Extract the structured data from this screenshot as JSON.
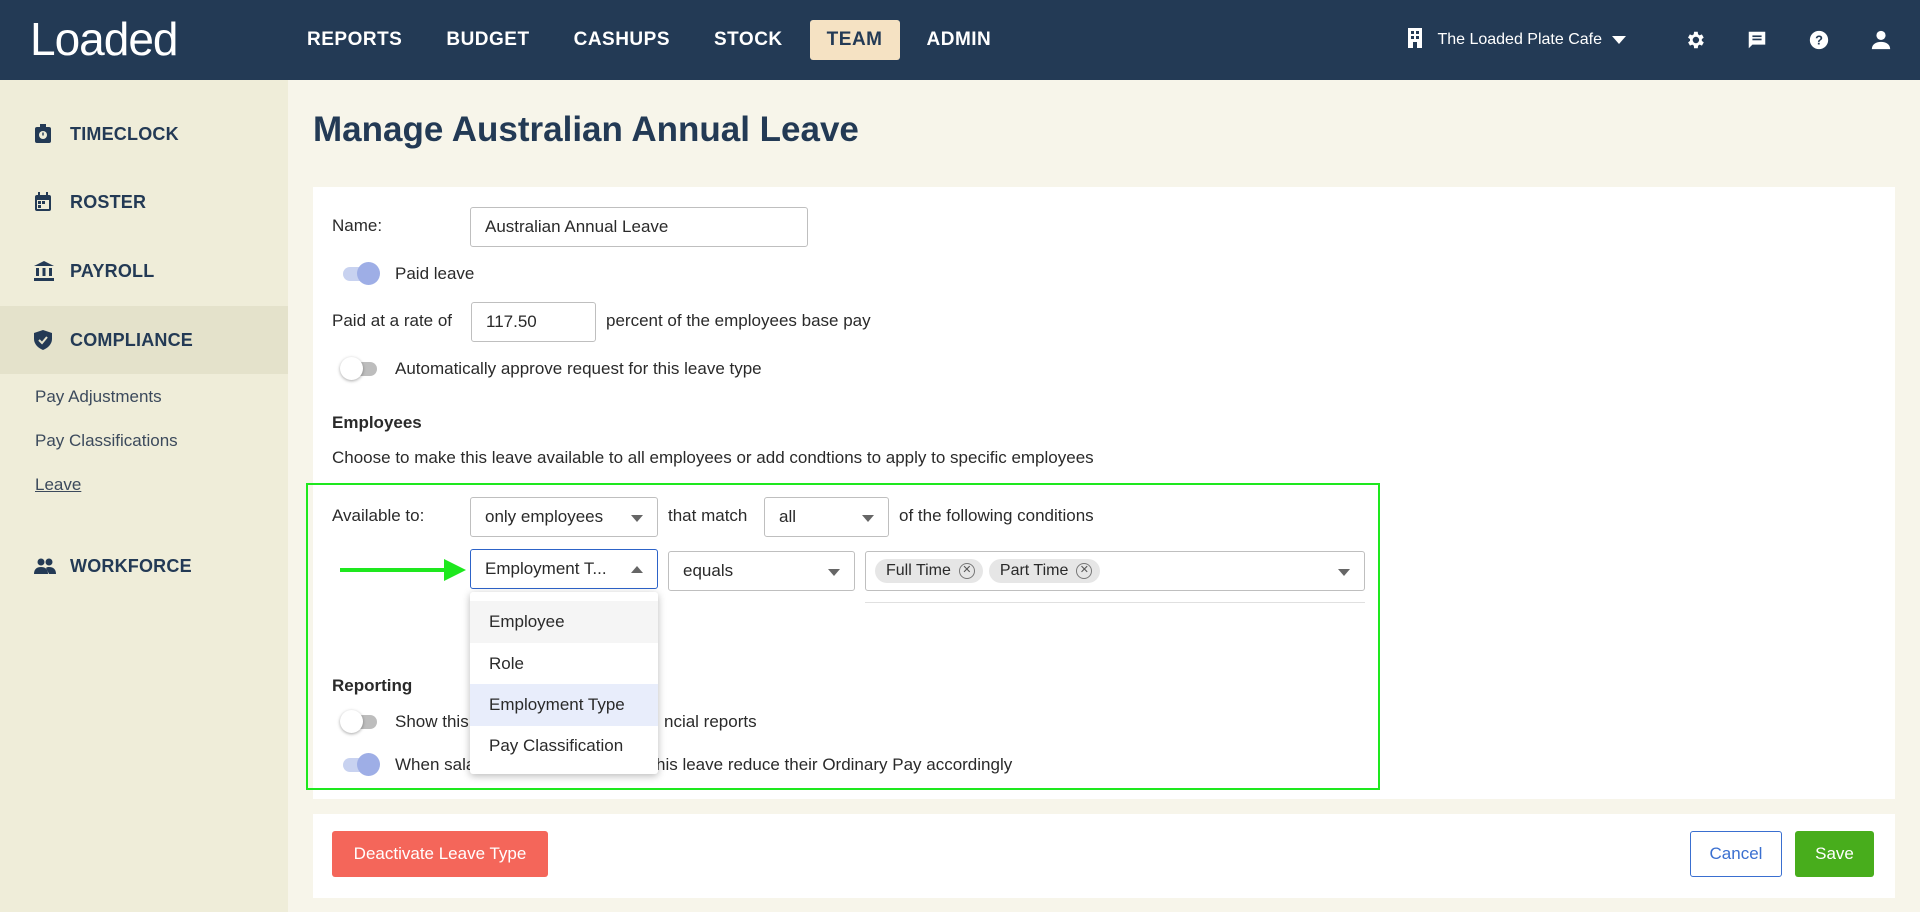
{
  "app": {
    "logo": "Loaded"
  },
  "nav": {
    "items": [
      {
        "label": "REPORTS"
      },
      {
        "label": "BUDGET"
      },
      {
        "label": "CASHUPS"
      },
      {
        "label": "STOCK"
      },
      {
        "label": "TEAM"
      },
      {
        "label": "ADMIN"
      }
    ],
    "active": "TEAM",
    "venue": "The Loaded Plate Cafe",
    "icons": [
      "settings-icon",
      "chat-icon",
      "help-icon",
      "user-icon"
    ]
  },
  "sidebar": {
    "items": [
      {
        "label": "TIMECLOCK",
        "icon": "timeclock-icon"
      },
      {
        "label": "ROSTER",
        "icon": "calendar-icon"
      },
      {
        "label": "PAYROLL",
        "icon": "bank-icon"
      },
      {
        "label": "COMPLIANCE",
        "icon": "shield-icon"
      },
      {
        "label": "WORKFORCE",
        "icon": "people-icon"
      }
    ],
    "active": "COMPLIANCE",
    "compliance_sub": [
      {
        "label": "Pay Adjustments"
      },
      {
        "label": "Pay Classifications"
      },
      {
        "label": "Leave"
      }
    ],
    "current_sub": "Leave"
  },
  "page": {
    "title": "Manage Australian Annual Leave"
  },
  "form": {
    "name_label": "Name:",
    "name_value": "Australian Annual Leave",
    "paid_leave_label": "Paid leave",
    "paid_leave_on": true,
    "rate_prefix": "Paid at a rate of",
    "rate_value": "117.50",
    "rate_suffix": "percent of the employees base pay",
    "auto_approve_label": "Automatically approve request for this leave type",
    "auto_approve_on": false
  },
  "employees": {
    "heading": "Employees",
    "description": "Choose to make this leave available to all employees or add condtions to apply to specific employees",
    "available_label": "Available to:",
    "available_value": "only employees",
    "match_label": "that match",
    "match_value": "all",
    "conditions_label": "of the following conditions",
    "condition": {
      "field_value": "Employment T...",
      "operator_value": "equals",
      "values": [
        "Full Time",
        "Part Time"
      ]
    },
    "field_options": [
      {
        "label": "Employee"
      },
      {
        "label": "Role"
      },
      {
        "label": "Employment Type"
      },
      {
        "label": "Pay Classification"
      }
    ],
    "hovered_option": "Employee",
    "selected_option": "Employment Type"
  },
  "reporting": {
    "heading": "Reporting",
    "show_in_reports_text_left": "Show this",
    "show_in_reports_text_right": "ncial reports",
    "show_in_reports_on": false,
    "salaried_text_left": "When sala",
    "salaried_text_right": "his leave reduce their Ordinary Pay accordingly",
    "salaried_on": true
  },
  "actions": {
    "deactivate_label": "Deactivate Leave Type",
    "cancel_label": "Cancel",
    "save_label": "Save"
  },
  "colors": {
    "topbar": "#233a55",
    "active_nav": "#f5e2c3",
    "sidebar": "#efedd9",
    "highlight_border": "#1ee81e",
    "arrow": "#1ee81e",
    "danger": "#f4665a",
    "save": "#48ad1c",
    "cancel_text": "#3a6fd0"
  }
}
